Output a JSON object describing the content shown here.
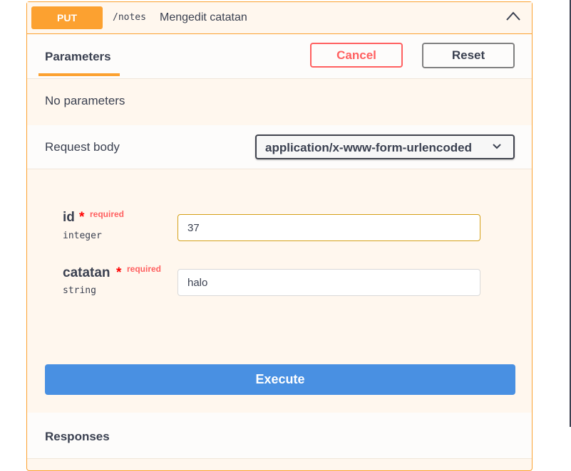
{
  "operation": {
    "method": "PUT",
    "path": "/notes",
    "description": "Mengedit catatan",
    "collapse_icon": "chevron-up-icon"
  },
  "tabs": {
    "parameters_label": "Parameters",
    "cancel_label": "Cancel",
    "reset_label": "Reset"
  },
  "parameters": {
    "empty_text": "No parameters"
  },
  "request_body": {
    "label": "Request body",
    "content_type": "application/x-www-form-urlencoded",
    "dropdown_icon": "chevron-down-icon",
    "fields": [
      {
        "name": "id",
        "star": "*",
        "required_text": "required",
        "type": "integer",
        "value": "37"
      },
      {
        "name": "catatan",
        "star": "*",
        "required_text": "required",
        "type": "string",
        "value": "halo"
      }
    ]
  },
  "execute_label": "Execute",
  "responses_label": "Responses",
  "colors": {
    "method_put": "#fca130",
    "cancel": "#ff6060",
    "execute": "#4990e2",
    "required": "#ff6060"
  }
}
